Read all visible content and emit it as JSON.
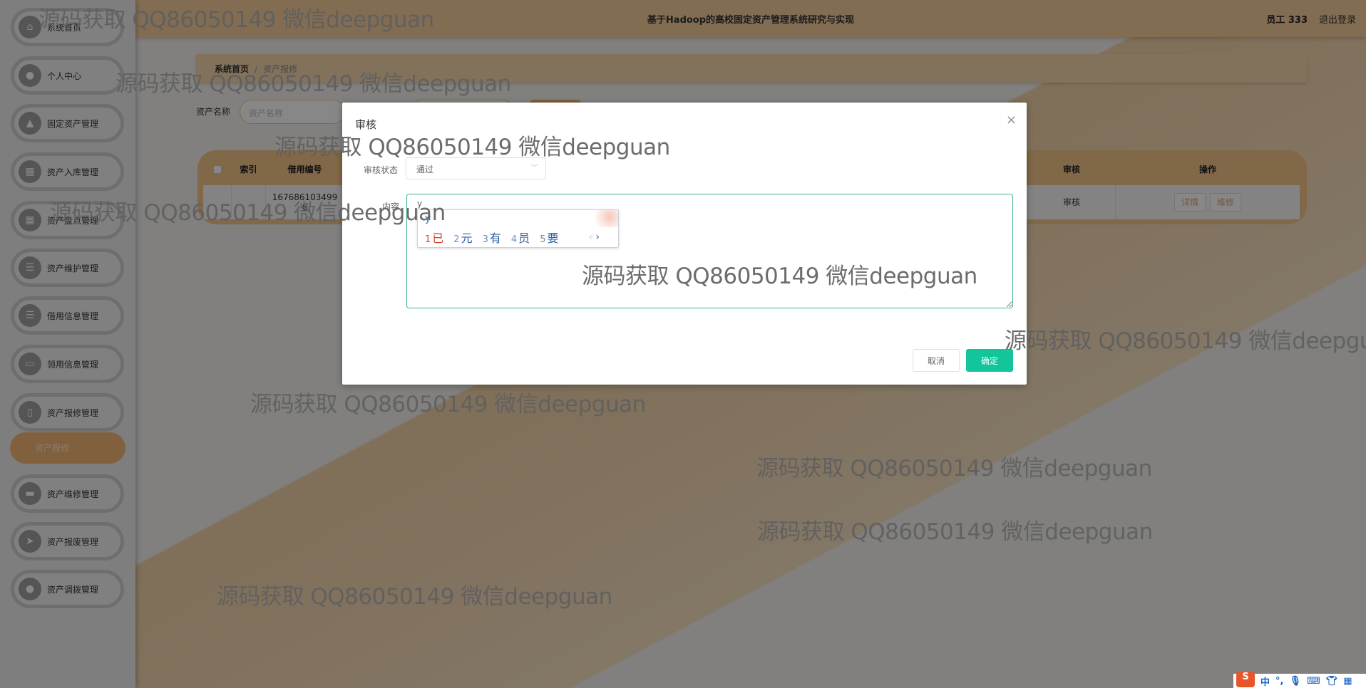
{
  "header": {
    "title": "基于Hadoop的高校固定资产管理系统研究与实现",
    "user": "员工 333",
    "logout": "退出登录"
  },
  "sidebar": {
    "items": [
      {
        "label": "系统首页",
        "icon": "home-icon",
        "glyph": "⌂"
      },
      {
        "label": "个人中心",
        "icon": "user-icon",
        "glyph": "●"
      },
      {
        "label": "固定资产管理",
        "icon": "stamp-icon",
        "glyph": "▲"
      },
      {
        "label": "资产入库管理",
        "icon": "grid-icon",
        "glyph": "▦"
      },
      {
        "label": "资产盘点管理",
        "icon": "apps-icon",
        "glyph": "▦"
      },
      {
        "label": "资产维护管理",
        "icon": "list-icon",
        "glyph": "☰"
      },
      {
        "label": "借用信息管理",
        "icon": "list-icon",
        "glyph": "☰"
      },
      {
        "label": "领用信息管理",
        "icon": "monitor-icon",
        "glyph": "▭"
      },
      {
        "label": "资产报修管理",
        "icon": "clipboard-icon",
        "glyph": "▯"
      },
      {
        "label": "资产维修管理",
        "icon": "ticket-icon",
        "glyph": "▬"
      },
      {
        "label": "资产报废管理",
        "icon": "send-icon",
        "glyph": "➤"
      },
      {
        "label": "资产调拨管理",
        "icon": "user-icon",
        "glyph": "●"
      }
    ],
    "active_sub": "资产报修"
  },
  "breadcrumb": {
    "home": "系统首页",
    "separator": "/",
    "current": "资产报修"
  },
  "search": {
    "label": "资产名称",
    "placeholder": "资产名称"
  },
  "table": {
    "headers": {
      "index": "索引",
      "code": "借用编号",
      "audit": "审核",
      "actions": "操作"
    },
    "row": {
      "code": "1676861034996",
      "audit": "审核",
      "detail": "详情",
      "repair": "维修"
    }
  },
  "modal": {
    "title": "审核",
    "close": "×",
    "status_label": "审核状态",
    "status_value": "通过",
    "content_label": "内容",
    "content_value": "y",
    "cancel": "取消",
    "confirm": "确定"
  },
  "ime": {
    "composition": "y",
    "candidates": [
      {
        "n": "1",
        "c": "已"
      },
      {
        "n": "2",
        "c": "元"
      },
      {
        "n": "3",
        "c": "有"
      },
      {
        "n": "4",
        "c": "员"
      },
      {
        "n": "5",
        "c": "要"
      }
    ],
    "toolbar": {
      "logo": "S",
      "lang": "中",
      "punct": "°,"
    }
  },
  "watermark": "源码获取 QQ86050149 微信deepguan",
  "colors": {
    "accent": "#f3b874",
    "confirm": "#12c59a",
    "header": "#f6cf9b"
  }
}
